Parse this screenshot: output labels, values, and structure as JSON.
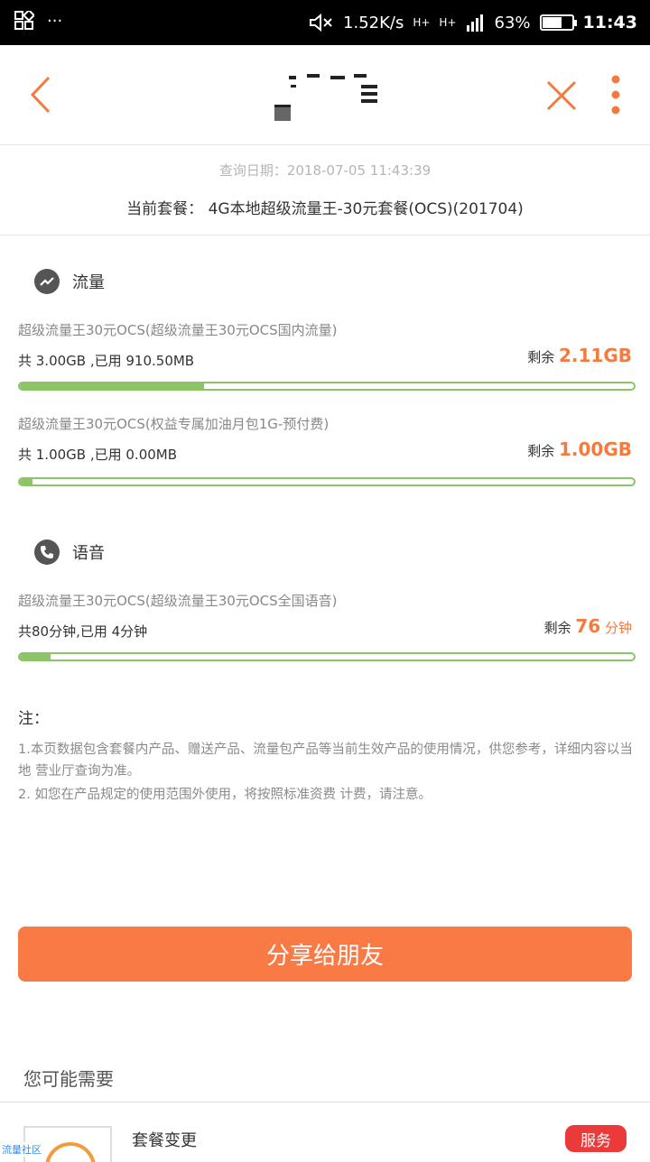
{
  "status_bar": {
    "speed": "1.52K/s",
    "network1": "H+",
    "network2": "H+",
    "battery": "63%",
    "battery_level": 0.63,
    "time": "11:43"
  },
  "header": {
    "back_icon": "chevron-left-icon",
    "close_icon": "close-icon",
    "more_icon": "more-vertical-icon",
    "accent_color": "#f47b3f"
  },
  "info": {
    "query_date": "查询日期：2018-07-05 11:43:39",
    "plan": "当前套餐：  4G本地超级流量王-30元套餐(OCS)(201704)"
  },
  "sections": {
    "data": {
      "title": "流量",
      "icon": "trend-icon",
      "items": [
        {
          "name": "超级流量王30元OCS(超级流量王30元OCS国内流量)",
          "usage": "共 3.00GB ,已用 910.50MB",
          "remain_label": "剩余",
          "remain_value": "2.11GB",
          "used_fraction": 0.3
        },
        {
          "name": "超级流量王30元OCS(权益专属加油月包1G-预付费)",
          "usage": "共 1.00GB ,已用 0.00MB",
          "remain_label": "剩余",
          "remain_value": "1.00GB",
          "used_fraction": 0.02
        }
      ]
    },
    "voice": {
      "title": "语音",
      "icon": "phone-icon",
      "items": [
        {
          "name": "超级流量王30元OCS(超级流量王30元OCS全国语音)",
          "usage": "共80分钟,已用 4分钟",
          "remain_label": "剩余",
          "remain_value": "76",
          "remain_unit": "分钟",
          "used_fraction": 0.05
        }
      ]
    }
  },
  "notes": {
    "title": "注：",
    "line1": "1.本页数据包含套餐内产品、赠送产品、流量包产品等当前生效产品的使用情况，供您参考，详细内容以当地 营业厅查询为准。",
    "line2": "2. 如您在产品规定的使用范围外使用，将按照标准资费 计费，请注意。"
  },
  "share_button": "分享给朋友",
  "recommend": {
    "title": "您可能需要",
    "items": [
      {
        "title": "套餐变更",
        "badge": "服务",
        "thumb_label": "流量社区"
      }
    ]
  }
}
